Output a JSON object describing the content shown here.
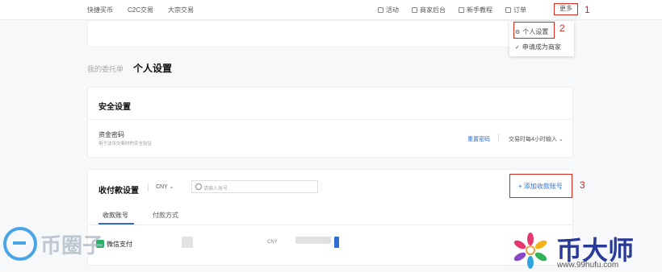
{
  "topnav": {
    "links": [
      "快捷买币",
      "C2C交易",
      "大宗交易"
    ],
    "activity": "活动",
    "merchant": "商家后台",
    "tutorial": "新手教程",
    "orders": "订单",
    "more": "更多"
  },
  "annotations": [
    "1",
    "2",
    "3"
  ],
  "dropdown": {
    "personal_settings": "个人设置",
    "apply_merchant": "申请成为商家"
  },
  "tabs": {
    "my_orders": "我的委托单",
    "personal_settings": "个人设置"
  },
  "security": {
    "title": "安全设置",
    "fund_password": "资金密码",
    "fund_password_desc": "用于法币交易时的安全验证",
    "reset": "重置密码",
    "rule": "交易时每4小时输入"
  },
  "payment": {
    "title": "收付款设置",
    "currency": "CNY",
    "search_placeholder": "请输入账号",
    "add_account": "+ 添加收款账号",
    "tab_receive": "收款账号",
    "tab_methods": "付款方式",
    "row_method": "微信支付",
    "row_currency": "CNY"
  },
  "watermark": {
    "left_text": "币圈子",
    "right_text": "币大师",
    "right_url": "www.99hufu.com"
  },
  "colors": {
    "accent_red": "#d9261c",
    "link_blue": "#2f6fd4"
  }
}
